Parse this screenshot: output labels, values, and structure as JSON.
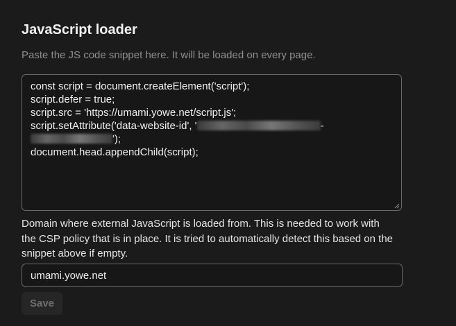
{
  "section": {
    "title": "JavaScript loader",
    "subtitle": "Paste the JS code snippet here. It will be loaded on every page."
  },
  "code": {
    "lines": [
      "const script = document.createElement('script');",
      "script.defer = true;",
      "script.src = 'https://umami.yowe.net/script.js';",
      "script.setAttribute('data-website-id', '",
      "');",
      "document.head.appendChild(script);"
    ]
  },
  "domain": {
    "help": "Domain where external JavaScript is loaded from. This is needed to work with the CSP policy that is in place. It is tried to automatically detect this based on the snippet above if empty.",
    "value": "umami.yowe.net"
  },
  "actions": {
    "save_label": "Save"
  }
}
